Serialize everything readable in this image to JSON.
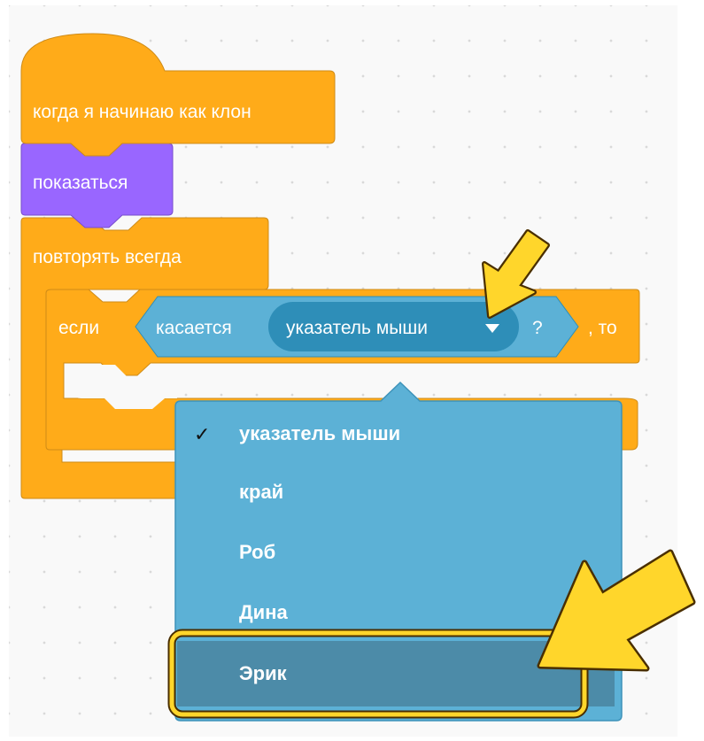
{
  "workspace": {
    "hat_block_label": "когда я начинаю как клон",
    "show_block_label": "показаться",
    "forever_block_label": "повторять всегда",
    "if_block": {
      "if_label": "если",
      "then_label": ", то",
      "touching_label": "касается",
      "touching_dropdown_value": "указатель мыши",
      "question_mark": "?"
    }
  },
  "dropdown_menu": {
    "check_mark": "✓",
    "items": [
      {
        "label": "указатель мыши",
        "checked": true
      },
      {
        "label": "край",
        "checked": false
      },
      {
        "label": "Роб",
        "checked": false
      },
      {
        "label": "Дина",
        "checked": false
      },
      {
        "label": "Эрик",
        "checked": false,
        "highlighted": true
      }
    ]
  },
  "colors": {
    "events_orange": "#ffab19",
    "events_border": "#cf8b17",
    "looks_purple": "#9966ff",
    "sensing_blue": "#5cb1d6",
    "sensing_dark": "#2e8eb8",
    "menu_highlight": "#4c8ba8",
    "arrow_yellow": "#ffd62b",
    "arrow_outline": "#4a2f00"
  }
}
